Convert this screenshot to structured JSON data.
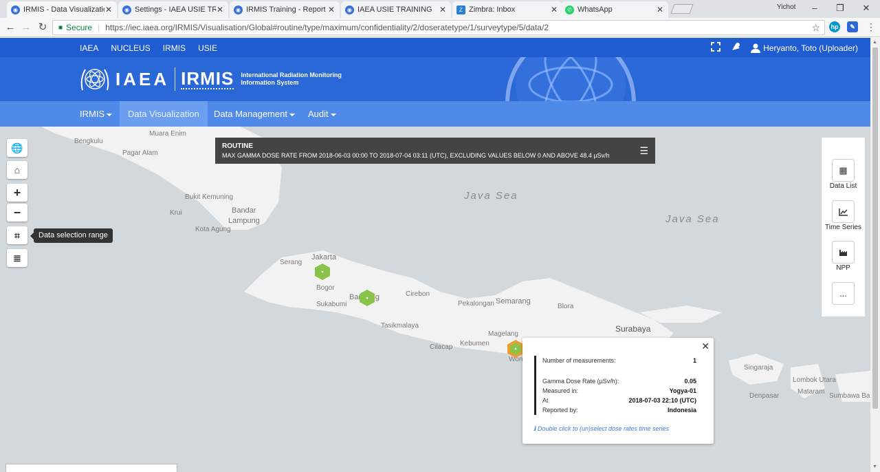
{
  "browser": {
    "tabs": [
      {
        "title": "IRMIS - Data Visualization",
        "favicon": "iaea-icon",
        "active": true
      },
      {
        "title": "Settings - IAEA USIE TRAI",
        "favicon": "iaea-icon"
      },
      {
        "title": "IRMIS Training - Report",
        "favicon": "iaea-icon"
      },
      {
        "title": "IAEA USIE TRAINING",
        "favicon": "iaea-icon"
      },
      {
        "title": "Zimbra: Inbox",
        "favicon": "zimbra-icon"
      },
      {
        "title": "WhatsApp",
        "favicon": "whatsapp-icon"
      }
    ],
    "user": "Yichot",
    "secure_label": "Secure",
    "url": "https://iec.iaea.org/IRMIS/Visualisation/Global#routine/type/maximum/confidentiality/2/doseratetype/1/surveytype/5/data/2"
  },
  "header": {
    "top_links": [
      "IAEA",
      "NUCLEUS",
      "IRMIS",
      "USIE"
    ],
    "user_label": "Heryanto, Toto (Uploader)",
    "logo_iaea": "IAEA",
    "logo_irmis": "IRMIS",
    "logo_sub_line1": "International Radiation Monitoring",
    "logo_sub_line2": "Information System"
  },
  "mainnav": {
    "irmis": "IRMIS",
    "data_visualization": "Data Visualization",
    "data_management": "Data Management",
    "audit": "Audit"
  },
  "map": {
    "tooltip": "Data selection range",
    "infobar": {
      "title": "ROUTINE",
      "subtitle": "MAX GAMMA DOSE RATE FROM 2018-06-03 00:00 TO 2018-07-04 03:11 (UTC), EXCLUDING VALUES BELOW 0 AND ABOVE 48.4 µSv/h"
    },
    "labels": {
      "bengkulu": "Bengkulu",
      "muara_enim": "Muara Enim",
      "pagar_alam": "Pagar Alam",
      "bukit_kemuning": "Bukit Kemuning",
      "krui": "Krui",
      "bandar_lampung_1": "Bandar",
      "bandar_lampung_2": "Lampung",
      "kota_agung": "Kota Agung",
      "java_sea_1": "Java Sea",
      "java_sea_2": "Java Sea",
      "serang": "Serang",
      "jakarta": "Jakarta",
      "bogor": "Bogor",
      "sukabumi": "Sukabumi",
      "bandung": "Bandung",
      "cirebon": "Cirebon",
      "tasikmalaya": "Tasikmalaya",
      "pekalongan": "Pekalongan",
      "semarang": "Semarang",
      "blora": "Blora",
      "surabaya": "Surabaya",
      "magelang": "Magelang",
      "kebumen": "Kebumen",
      "cilacap": "Cilacap",
      "wonosari": "Won",
      "singaraja": "Singaraja",
      "lombok_utara": "Lombok Utara",
      "mataram": "Mataram",
      "denpasar": "Denpasar",
      "sumbawa_barat": "Sumbawa Bar"
    }
  },
  "sidepanel": {
    "data_list": "Data List",
    "time_series": "Time Series",
    "npp": "NPP",
    "more": "..."
  },
  "popup": {
    "measurements_label": "Number of measurements:",
    "measurements_value": "1",
    "dose_label": "Gamma Dose Rate (µSv/h):",
    "dose_value": "0.05",
    "measured_label": "Measured in:",
    "measured_value": "Yogya-01",
    "at_label": "At",
    "at_value": "2018-07-03 22:10 (UTC)",
    "reported_label": "Reported by:",
    "reported_value": "Indonesia",
    "hint": "Double click to (un)select dose rates time series"
  },
  "colors": {
    "header_dark": "#1f5cd1",
    "header_mid": "#2a68d8",
    "nav": "#4f8ae8",
    "marker_green": "#8bc34a",
    "marker_orange": "#f29b2e",
    "map_sea": "#d3d8dc",
    "map_land": "#f2f2f2"
  }
}
